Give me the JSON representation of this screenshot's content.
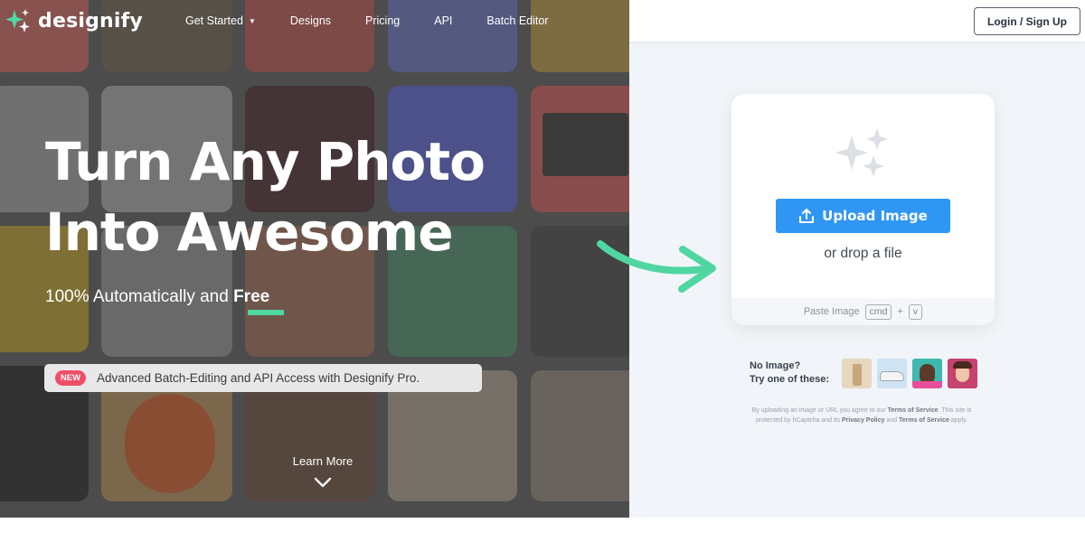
{
  "brand": {
    "name": "designify",
    "mint": "#4fd6a1",
    "blue": "#2f96f3",
    "red": "#ef4e67"
  },
  "nav": {
    "items": [
      {
        "label": "Get Started",
        "has_dropdown": true
      },
      {
        "label": "Designs"
      },
      {
        "label": "Pricing"
      },
      {
        "label": "API"
      },
      {
        "label": "Batch Editor"
      }
    ],
    "login_label": "Login / Sign Up"
  },
  "hero": {
    "headline_line1": "Turn Any Photo",
    "headline_line2": "Into Awesome",
    "sub_prefix": "100% Automatically and ",
    "sub_highlight": "Free",
    "promo_badge": "NEW",
    "promo_text": "Advanced Batch-Editing and API Access with Designify Pro.",
    "learn_more": "Learn More"
  },
  "upload": {
    "button_label": "Upload Image",
    "drop_text": "or drop a file",
    "paste_label": "Paste Image",
    "key1": "cmd",
    "plus": "+",
    "key2": "v"
  },
  "samples": {
    "line1": "No Image?",
    "line2": "Try one of these:",
    "items": [
      "product-bottle",
      "car",
      "man-portrait",
      "woman-portrait"
    ]
  },
  "legal": {
    "t1": "By uploading an image or URL you agree to our ",
    "tos": "Terms of Service",
    "t2": ". This site is protected by hCaptcha and its ",
    "privacy": "Privacy Policy",
    "t3": " and ",
    "tos2": "Terms of Service",
    "t4": " apply."
  }
}
